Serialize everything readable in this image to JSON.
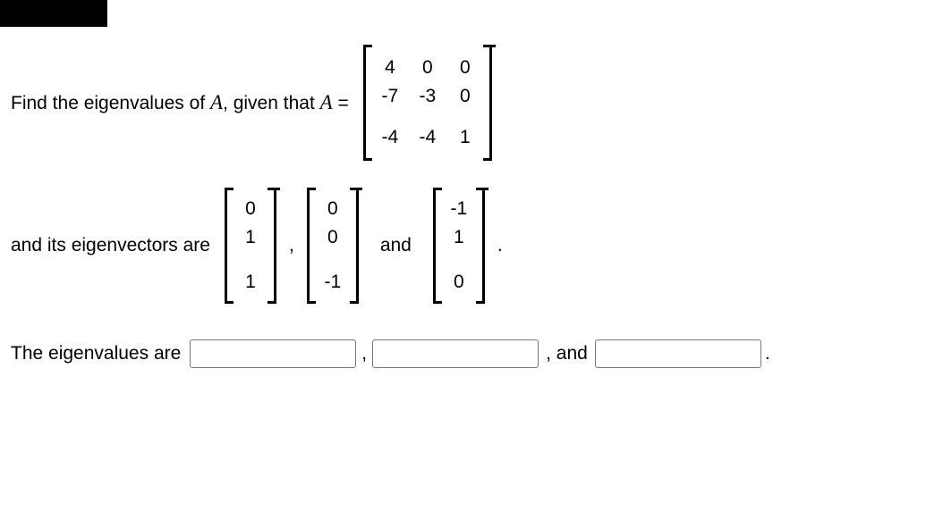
{
  "prompt": {
    "part1": "Find the eigenvalues of ",
    "var1": "A",
    "part2": ", given that ",
    "var2": "A",
    "eq": " = "
  },
  "matrixA": {
    "r0": {
      "c0": "4",
      "c1": "0",
      "c2": "0"
    },
    "r1": {
      "c0": "-7",
      "c1": "-3",
      "c2": "0"
    },
    "r2": {
      "c0": "-4",
      "c1": "-4",
      "c2": "1"
    }
  },
  "eigtext": {
    "lead": "and its eigenvectors are",
    "sep1": ",",
    "sep2": "and",
    "end": "."
  },
  "v1": {
    "a": "0",
    "b": "1",
    "c": "1"
  },
  "v2": {
    "a": "0",
    "b": "0",
    "c": "-1"
  },
  "v3": {
    "a": "-1",
    "b": "1",
    "c": "0"
  },
  "answer": {
    "lead": "The eigenvalues are",
    "sep1": ",",
    "sep2": ", and",
    "end": "."
  }
}
